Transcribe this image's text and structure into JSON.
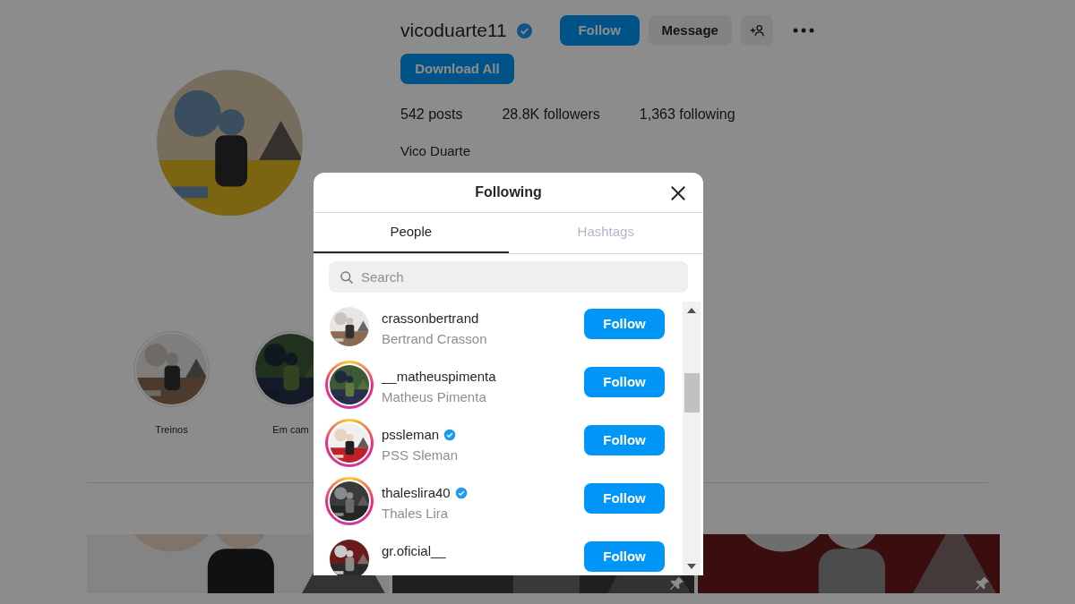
{
  "profile": {
    "username": "vicoduarte11",
    "verified": true,
    "buttons": [
      {
        "label": "Follow",
        "kind": "primary"
      },
      {
        "label": "Message",
        "kind": "secondary"
      }
    ],
    "download_button": "Download All",
    "stats": [
      "542 posts",
      "28.8K followers",
      "1,363 following"
    ],
    "full_name": "Vico Duarte"
  },
  "highlights": [
    {
      "label": "Treinos"
    },
    {
      "label": "Em cam"
    }
  ],
  "posts": [
    {
      "pinned": false
    },
    {
      "pinned": true
    },
    {
      "pinned": true
    }
  ],
  "modal": {
    "title": "Following",
    "tabs": [
      {
        "label": "People",
        "selected": true
      },
      {
        "label": "Hashtags",
        "selected": false
      }
    ],
    "search": {
      "placeholder": "Search"
    },
    "rows": [
      {
        "username": "crassonbertrand",
        "full_name": "Bertrand Crasson",
        "verified": false,
        "story_ring": false,
        "button": "Follow"
      },
      {
        "username": "__matheuspimenta",
        "full_name": "Matheus Pimenta",
        "verified": false,
        "story_ring": true,
        "button": "Follow"
      },
      {
        "username": "pssleman",
        "full_name": "PSS Sleman",
        "verified": true,
        "story_ring": true,
        "button": "Follow"
      },
      {
        "username": "thaleslira40",
        "full_name": "Thales Lira",
        "verified": true,
        "story_ring": true,
        "button": "Follow"
      },
      {
        "username": "gr.oficial__",
        "verified": false,
        "story_ring": false,
        "button": "Follow"
      }
    ]
  }
}
